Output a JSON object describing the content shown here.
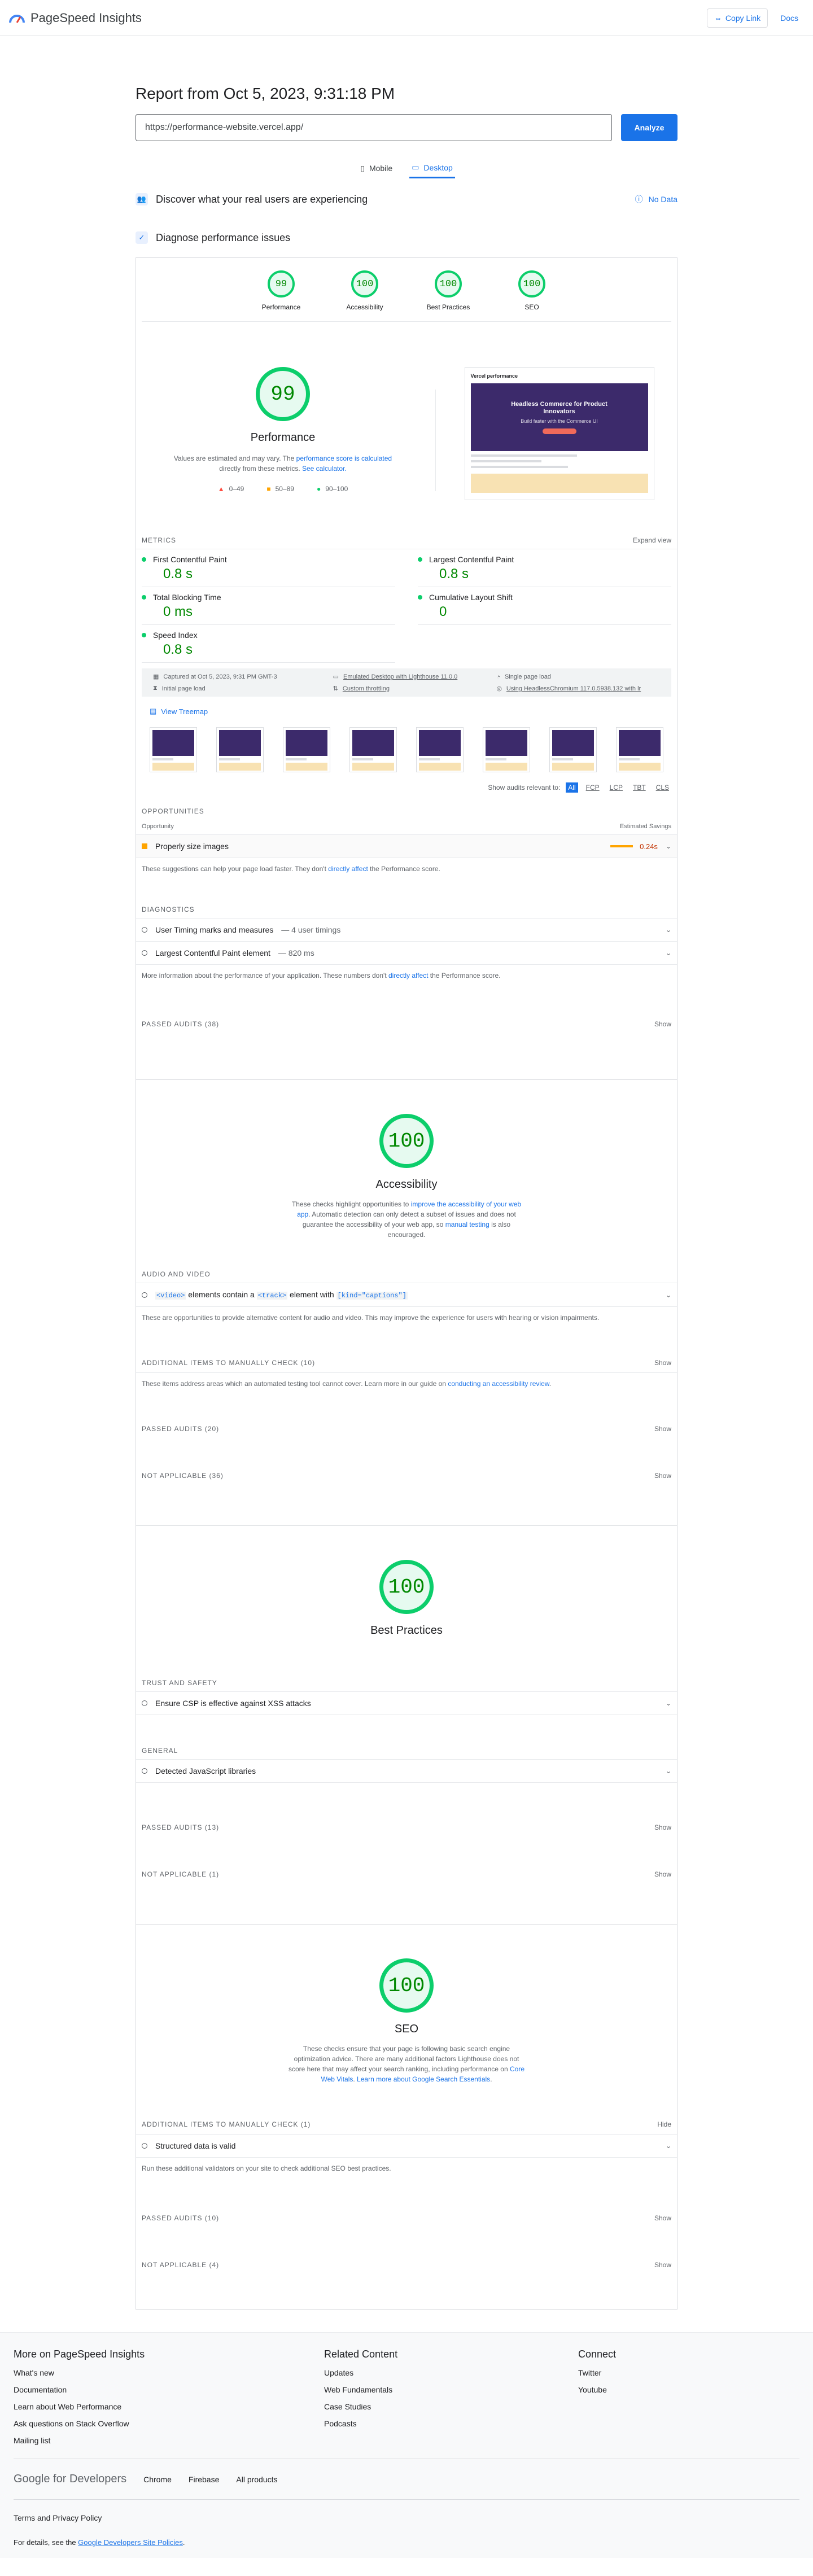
{
  "header": {
    "app_name": "PageSpeed Insights",
    "copy_link": "Copy Link",
    "docs": "Docs"
  },
  "report": {
    "title": "Report from Oct 5, 2023, 9:31:18 PM",
    "url": "https://performance-website.vercel.app/",
    "analyze": "Analyze",
    "tabs": {
      "mobile": "Mobile",
      "desktop": "Desktop"
    },
    "discover": "Discover what your real users are experiencing",
    "no_data": "No Data",
    "diagnose": "Diagnose performance issues"
  },
  "scores": [
    {
      "label": "Performance",
      "value": "99"
    },
    {
      "label": "Accessibility",
      "value": "100"
    },
    {
      "label": "Best Practices",
      "value": "100"
    },
    {
      "label": "SEO",
      "value": "100"
    }
  ],
  "perf": {
    "score": "99",
    "title": "Performance",
    "note_a": "Values are estimated and may vary. The ",
    "note_link1": "performance score is calculated",
    "note_b": " directly from these metrics. ",
    "note_link2": "See calculator.",
    "legend": [
      "0–49",
      "50–89",
      "90–100"
    ],
    "screenshot": {
      "heading": "Vercel performance",
      "hero": "Headless Commerce for Product Innovators",
      "sub": "Build faster with the Commerce UI"
    }
  },
  "metrics": {
    "head": "METRICS",
    "expand": "Expand view",
    "items": [
      {
        "name": "First Contentful Paint",
        "value": "0.8 s"
      },
      {
        "name": "Largest Contentful Paint",
        "value": "0.8 s"
      },
      {
        "name": "Total Blocking Time",
        "value": "0 ms"
      },
      {
        "name": "Cumulative Layout Shift",
        "value": "0"
      },
      {
        "name": "Speed Index",
        "value": "0.8 s"
      }
    ]
  },
  "runinfo": {
    "captured": "Captured at Oct 5, 2023, 9:31 PM GMT-3",
    "emulated": "Emulated Desktop with Lighthouse 11.0.0",
    "single": "Single page load",
    "initial": "Initial page load",
    "throttling": "Custom throttling",
    "browser": "Using HeadlessChromium 117.0.5938.132 with lr"
  },
  "treemap": "View Treemap",
  "relevant": {
    "label": "Show audits relevant to:",
    "chips": [
      "All",
      "FCP",
      "LCP",
      "TBT",
      "CLS"
    ]
  },
  "opportunities": {
    "head": "OPPORTUNITIES",
    "col_left": "Opportunity",
    "col_right": "Estimated Savings",
    "item": "Properly size images",
    "saving": "0.24s",
    "note_a": "These suggestions can help your page load faster. They don't ",
    "note_link": "directly affect",
    "note_b": " the Performance score."
  },
  "diagnostics": {
    "head": "DIAGNOSTICS",
    "items": [
      {
        "name": "User Timing marks and measures",
        "detail": " — 4 user timings"
      },
      {
        "name": "Largest Contentful Paint element",
        "detail": " — 820 ms"
      }
    ],
    "note_a": "More information about the performance of your application. These numbers don't ",
    "note_link": "directly affect",
    "note_b": " the Performance score.",
    "passed": "PASSED AUDITS (38)",
    "show": "Show"
  },
  "accessibility": {
    "score": "100",
    "title": "Accessibility",
    "desc_a": "These checks highlight opportunities to ",
    "desc_link1": "improve the accessibility of your web app",
    "desc_b": ". Automatic detection can only detect a subset of issues and does not guarantee the accessibility of your web app, so ",
    "desc_link2": "manual testing",
    "desc_c": " is also encouraged.",
    "av_head": "AUDIO AND VIDEO",
    "av_code1": "<video>",
    "av_mid": " elements contain a ",
    "av_code2": "<track>",
    "av_mid2": " element with ",
    "av_code3": "[kind=\"captions\"]",
    "av_note": "These are opportunities to provide alternative content for audio and video. This may improve the experience for users with hearing or vision impairments.",
    "manual": "ADDITIONAL ITEMS TO MANUALLY CHECK (10)",
    "manual_note_a": "These items address areas which an automated testing tool cannot cover. Learn more in our guide on ",
    "manual_note_link": "conducting an accessibility review",
    "manual_note_b": ".",
    "passed": "PASSED AUDITS (20)",
    "na": "NOT APPLICABLE (36)",
    "show": "Show"
  },
  "best_practices": {
    "score": "100",
    "title": "Best Practices",
    "trust_head": "TRUST AND SAFETY",
    "trust_item": "Ensure CSP is effective against XSS attacks",
    "general_head": "GENERAL",
    "general_item": "Detected JavaScript libraries",
    "passed": "PASSED AUDITS (13)",
    "na": "NOT APPLICABLE (1)",
    "show": "Show"
  },
  "seo": {
    "score": "100",
    "title": "SEO",
    "desc_a": "These checks ensure that your page is following basic search engine optimization advice. There are many additional factors Lighthouse does not score here that may affect your search ranking, including performance on ",
    "desc_link1": "Core Web Vitals",
    "desc_b": ". ",
    "desc_link2": "Learn more about Google Search Essentials",
    "desc_c": ".",
    "manual": "ADDITIONAL ITEMS TO MANUALLY CHECK (1)",
    "hide": "Hide",
    "manual_item": "Structured data is valid",
    "manual_note": "Run these additional validators on your site to check additional SEO best practices.",
    "passed": "PASSED AUDITS (10)",
    "na": "NOT APPLICABLE (4)",
    "show": "Show"
  },
  "footer": {
    "col1_title": "More on PageSpeed Insights",
    "col1": [
      "What's new",
      "Documentation",
      "Learn about Web Performance",
      "Ask questions on Stack Overflow",
      "Mailing list"
    ],
    "col2_title": "Related Content",
    "col2": [
      "Updates",
      "Web Fundamentals",
      "Case Studies",
      "Podcasts"
    ],
    "col3_title": "Connect",
    "col3": [
      "Twitter",
      "Youtube"
    ],
    "dev_logo": "Google for Developers",
    "dev_links": [
      "Chrome",
      "Firebase",
      "All products"
    ],
    "terms": "Terms and Privacy Policy",
    "details_a": "For details, see the ",
    "details_link": "Google Developers Site Policies",
    "details_b": "."
  },
  "colors": {
    "good": "#0cce6b",
    "good_text": "#008800",
    "average": "#ffa400",
    "poor": "#ff4e42",
    "accent": "#1a73e8"
  }
}
